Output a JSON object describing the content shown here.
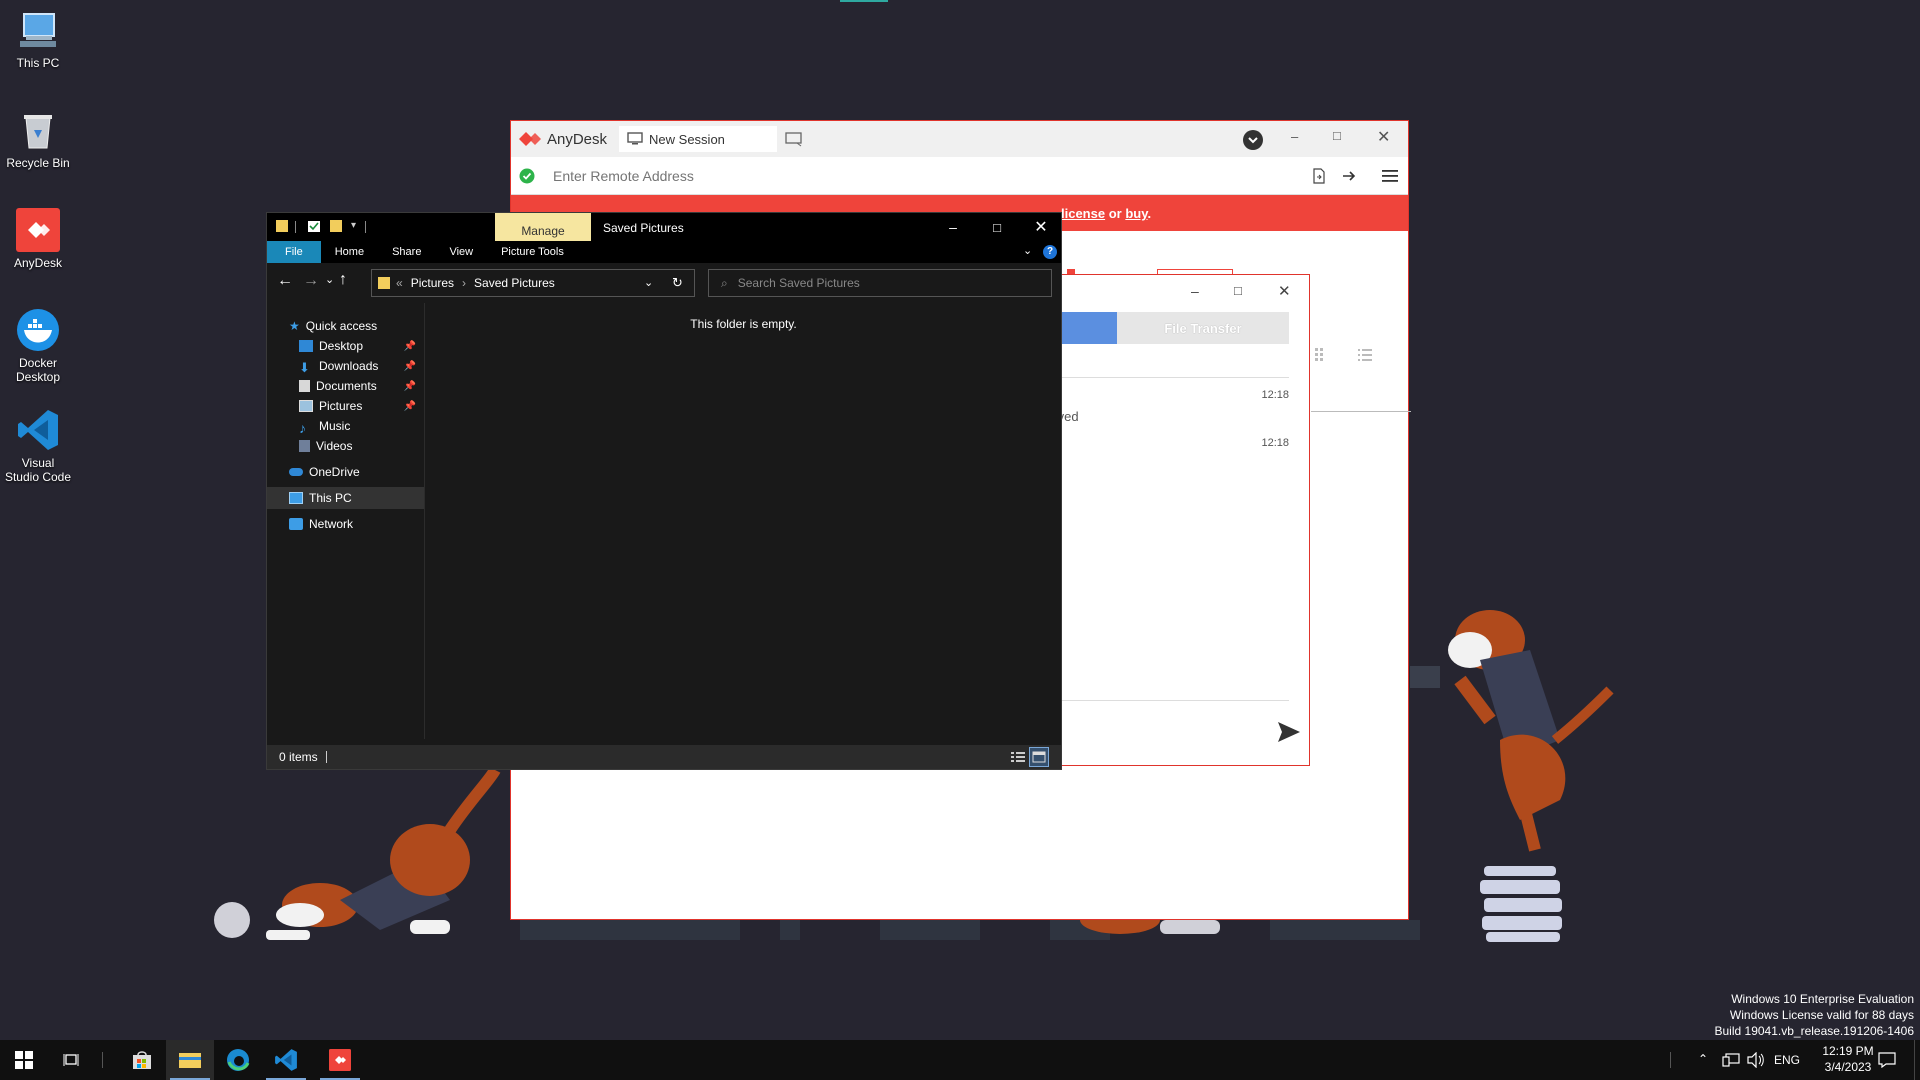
{
  "desktop": {
    "icons": [
      {
        "label": "This PC",
        "icon": "this-pc-icon"
      },
      {
        "label": "Recycle Bin",
        "icon": "recycle-bin-icon"
      },
      {
        "label": "AnyDesk",
        "icon": "anydesk-icon"
      },
      {
        "label": "Docker Desktop",
        "icon": "docker-icon"
      },
      {
        "label": "Visual Studio Code",
        "icon": "vscode-icon"
      }
    ],
    "watermark": {
      "line1": "Windows 10 Enterprise Evaluation",
      "line2": "Windows License valid for 88 days",
      "line3": "Build 19041.vb_release.191206-1406"
    }
  },
  "anydesk": {
    "app_name": "AnyDesk",
    "tab_label": "New Session",
    "address_placeholder": "Enter Remote Address",
    "banner": {
      "license_link": "license",
      "or_text": "or",
      "buy_link": "buy",
      "period": "."
    },
    "accent_color": "#ef443b"
  },
  "chat": {
    "file_transfer_tab": "File Transfer",
    "message_fragment": "ceived",
    "time1": "12:18",
    "time2": "12:18"
  },
  "explorer": {
    "title": "Saved Pictures",
    "manage_tab": "Manage",
    "ribbon_tabs": [
      "File",
      "Home",
      "Share",
      "View",
      "Picture Tools"
    ],
    "breadcrumb": {
      "root_sep": "«",
      "parent": "Pictures",
      "sep": "›",
      "current": "Saved Pictures"
    },
    "search_placeholder": "Search Saved Pictures",
    "empty_message": "This folder is empty.",
    "status_items": "0 items",
    "sidebar": {
      "quick_access": "Quick access",
      "items": [
        {
          "label": "Desktop",
          "pinned": true
        },
        {
          "label": "Downloads",
          "pinned": true
        },
        {
          "label": "Documents",
          "pinned": true
        },
        {
          "label": "Pictures",
          "pinned": true
        },
        {
          "label": "Music",
          "pinned": false
        },
        {
          "label": "Videos",
          "pinned": false
        }
      ],
      "onedrive": "OneDrive",
      "this_pc": "This PC",
      "network": "Network"
    }
  },
  "taskbar": {
    "language": "ENG",
    "time": "12:19 PM",
    "date": "3/4/2023"
  }
}
